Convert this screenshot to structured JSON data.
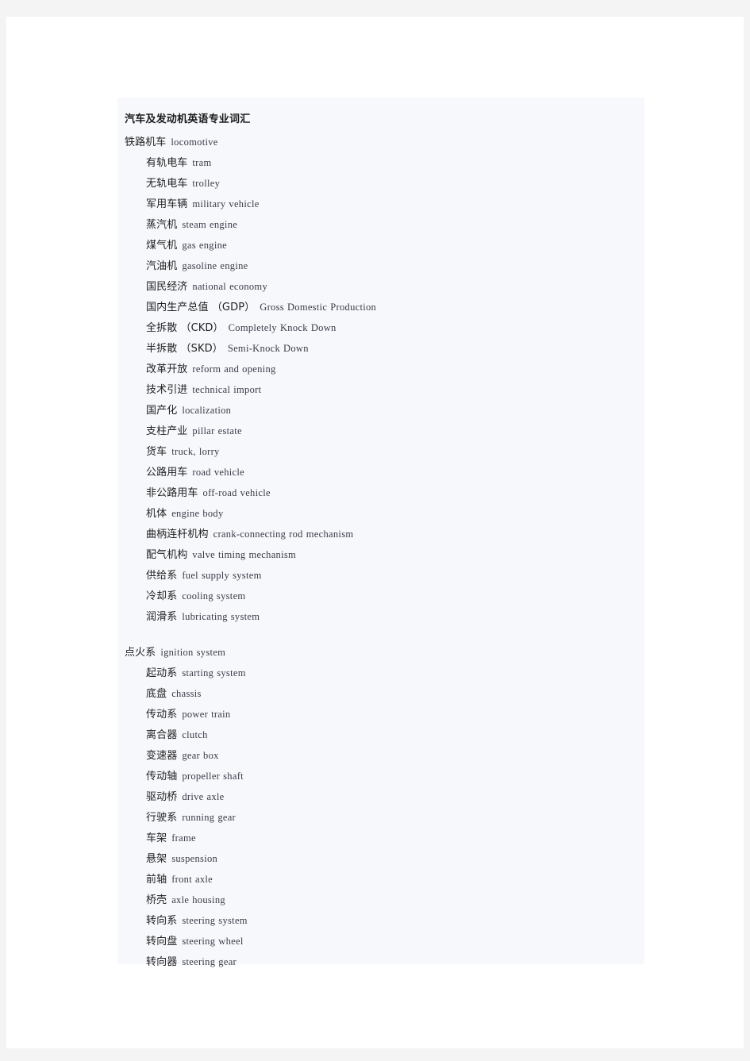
{
  "document": {
    "title": "汽车及发动机英语专业词汇",
    "colors": {
      "outer_background": "#f4f4f4",
      "page_background": "#ffffff",
      "content_block_background": "#f7f8fc",
      "chinese_text": "#1f1f1f",
      "english_text": "#3a3a46",
      "title_text": "#1a1a1a"
    },
    "entries": [
      {
        "cn": "铁路机车",
        "en": "locomotive",
        "indent": false,
        "gap_before": false
      },
      {
        "cn": "有轨电车",
        "en": "tram",
        "indent": true,
        "gap_before": false
      },
      {
        "cn": "无轨电车",
        "en": "trolley",
        "indent": true,
        "gap_before": false
      },
      {
        "cn": "军用车辆",
        "en": "military vehicle",
        "indent": true,
        "gap_before": false
      },
      {
        "cn": "蒸汽机",
        "en": "steam engine",
        "indent": true,
        "gap_before": false
      },
      {
        "cn": "煤气机",
        "en": "gas engine",
        "indent": true,
        "gap_before": false
      },
      {
        "cn": "汽油机",
        "en": "gasoline engine",
        "indent": true,
        "gap_before": false
      },
      {
        "cn": "国民经济",
        "en": "national economy",
        "indent": true,
        "gap_before": false
      },
      {
        "cn": "国内生产总值 （GDP）",
        "en": "Gross Domestic Production",
        "indent": true,
        "gap_before": false
      },
      {
        "cn": "全拆散 （CKD）",
        "en": "Completely Knock Down",
        "indent": true,
        "gap_before": false
      },
      {
        "cn": "半拆散 （SKD）",
        "en": "Semi-Knock Down",
        "indent": true,
        "gap_before": false
      },
      {
        "cn": "改革开放",
        "en": "reform and opening",
        "indent": true,
        "gap_before": false
      },
      {
        "cn": "技术引进",
        "en": "technical import",
        "indent": true,
        "gap_before": false
      },
      {
        "cn": "国产化",
        "en": "localization",
        "indent": true,
        "gap_before": false
      },
      {
        "cn": "支柱产业",
        "en": "pillar estate",
        "indent": true,
        "gap_before": false
      },
      {
        "cn": "货车",
        "en": "truck, lorry",
        "indent": true,
        "gap_before": false
      },
      {
        "cn": "公路用车",
        "en": "road vehicle",
        "indent": true,
        "gap_before": false
      },
      {
        "cn": "非公路用车",
        "en": "off-road vehicle",
        "indent": true,
        "gap_before": false
      },
      {
        "cn": "机体",
        "en": "engine body",
        "indent": true,
        "gap_before": false
      },
      {
        "cn": "曲柄连杆机构",
        "en": "crank-connecting rod mechanism",
        "indent": true,
        "gap_before": false
      },
      {
        "cn": "配气机构",
        "en": "valve timing mechanism",
        "indent": true,
        "gap_before": false
      },
      {
        "cn": "供给系",
        "en": "fuel supply system",
        "indent": true,
        "gap_before": false
      },
      {
        "cn": "冷却系",
        "en": "cooling system",
        "indent": true,
        "gap_before": false
      },
      {
        "cn": "润滑系",
        "en": "lubricating system",
        "indent": true,
        "gap_before": false
      },
      {
        "cn": "点火系",
        "en": "ignition system",
        "indent": false,
        "gap_before": true
      },
      {
        "cn": "起动系",
        "en": "starting system",
        "indent": true,
        "gap_before": false
      },
      {
        "cn": "底盘",
        "en": "chassis",
        "indent": true,
        "gap_before": false
      },
      {
        "cn": "传动系",
        "en": "power train",
        "indent": true,
        "gap_before": false
      },
      {
        "cn": "离合器",
        "en": "clutch",
        "indent": true,
        "gap_before": false
      },
      {
        "cn": "变速器",
        "en": "gear box",
        "indent": true,
        "gap_before": false
      },
      {
        "cn": "传动轴",
        "en": "propeller shaft",
        "indent": true,
        "gap_before": false
      },
      {
        "cn": "驱动桥",
        "en": "drive axle",
        "indent": true,
        "gap_before": false
      },
      {
        "cn": "行驶系",
        "en": "running gear",
        "indent": true,
        "gap_before": false
      },
      {
        "cn": "车架",
        "en": "frame",
        "indent": true,
        "gap_before": false
      },
      {
        "cn": "悬架",
        "en": "suspension",
        "indent": true,
        "gap_before": false
      },
      {
        "cn": "前轴",
        "en": "front axle",
        "indent": true,
        "gap_before": false
      },
      {
        "cn": "桥壳",
        "en": "axle housing",
        "indent": true,
        "gap_before": false
      },
      {
        "cn": "转向系",
        "en": "steering system",
        "indent": true,
        "gap_before": false
      },
      {
        "cn": "转向盘",
        "en": "steering wheel",
        "indent": true,
        "gap_before": false
      },
      {
        "cn": "转向器",
        "en": "steering gear",
        "indent": true,
        "gap_before": false
      }
    ]
  }
}
